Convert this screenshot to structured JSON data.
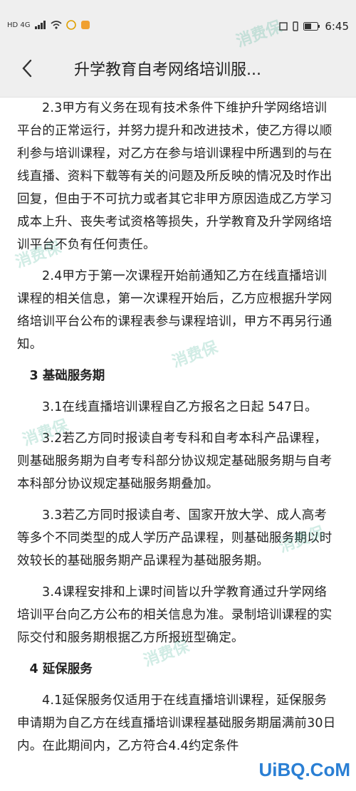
{
  "status_bar": {
    "left_text": "HD 4G",
    "time": "6:45"
  },
  "header": {
    "title": "升学教育自考网络培训服..."
  },
  "content": {
    "paragraphs": [
      "2.3甲方有义务在现有技术条件下维护升学网络培训平台的正常运行，并努力提升和改进技术，使乙方得以顺利参与培训课程，对乙方在参与培训课程中所遇到的与在线直播、资料下载等有关的问题及所反映的情况及时作出回复，但由于不可抗力或者其它非甲方原因造成乙方学习成本上升、丧失考试资格等损失，升学教育及升学网络培训平台不负有任何责任。",
      "2.4甲方于第一次课程开始前通知乙方在线直播培训课程的相关信息，第一次课程开始后，乙方应根据升学网络培训平台公布的课程表参与课程培训，甲方不再另行通知。"
    ],
    "section3_title": "3 基础服务期",
    "section3_paragraphs": [
      "3.1在线直播培训课程自乙方报名之日起 547日。",
      "3.2若乙方同时报读自考专科和自考本科产品课程，则基础服务期为自考专科部分协议规定基础服务期与自考本科部分协议规定基础服务期叠加。",
      "3.3若乙方同时报读自考、国家开放大学、成人高考等多个不同类型的成人学历产品课程，则基础服务期以时效较长的基础服务期产品课程为基础服务期。",
      "3.4课程安排和上课时间皆以升学教育通过升学网络培训平台向乙方公布的相关信息为准。录制培训课程的实际交付和服务期根据乙方所报班型确定。"
    ],
    "section4_title": "4 延保服务",
    "section4_paragraphs": [
      "4.1延保服务仅适用于在线直播培训课程，延保服务申请期为自乙方在线直播培训课程基础服务期届满前30日内。在此期间内，乙方符合4.4约定条件"
    ]
  },
  "watermark_text": "消费保",
  "corner_logo_text": "UiBQ.CoM",
  "colors": {
    "header_bg": "#efefef",
    "watermark": "#0a966e",
    "logo": "#2a7fd4"
  }
}
